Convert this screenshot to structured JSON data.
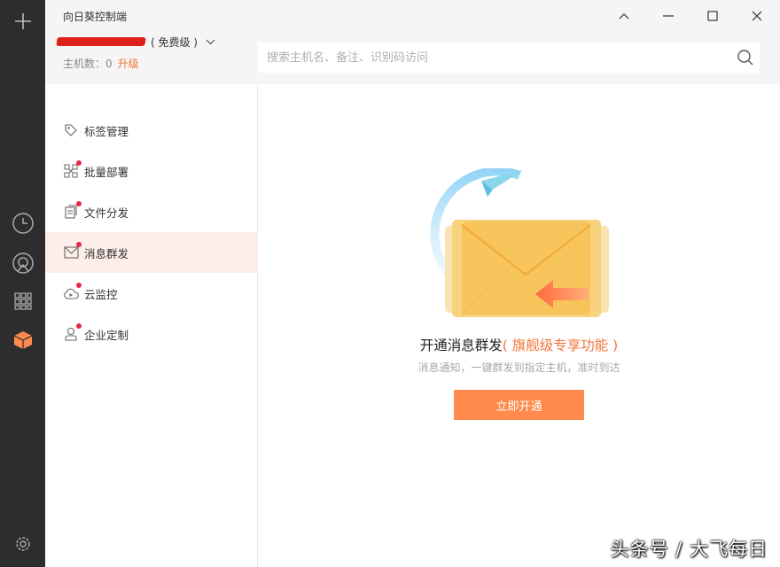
{
  "window": {
    "title": "向日葵控制端"
  },
  "account": {
    "tier": "( 免费级 )",
    "hosts_label": "主机数：0",
    "upgrade_label": "升级"
  },
  "search": {
    "placeholder": "搜索主机名、备注、识别码访问"
  },
  "sidebar": {
    "items": [
      {
        "label": "标签管理",
        "badge": false,
        "active": false
      },
      {
        "label": "批量部署",
        "badge": true,
        "active": false
      },
      {
        "label": "文件分发",
        "badge": true,
        "active": false
      },
      {
        "label": "消息群发",
        "badge": true,
        "active": true
      },
      {
        "label": "云监控",
        "badge": true,
        "active": false
      },
      {
        "label": "企业定制",
        "badge": true,
        "active": false
      }
    ]
  },
  "promo": {
    "title": "开通消息群发",
    "highlight": "( 旗舰级专享功能 )",
    "subtitle": "消息通知，一键群发到指定主机，准时到达",
    "button": "立即开通"
  },
  "watermark": "头条号 / 大飞每日",
  "colors": {
    "accent": "#ff8a4c",
    "highlight_text": "#f0763c",
    "rail": "#2d2d2d",
    "active_bg": "#fdeee8",
    "badge": "#e8264a",
    "envelope": "#f8c55c"
  },
  "icons": {
    "rail": [
      "plus-icon",
      "clock-icon",
      "remote-icon",
      "apps-grid-icon",
      "box-icon",
      "gear-icon"
    ],
    "sidebar": [
      "tag-icon",
      "deploy-icon",
      "file-icon",
      "mail-icon",
      "cloud-monitor-icon",
      "user-icon"
    ],
    "window": [
      "chevron-up-icon",
      "minimize-icon",
      "maximize-icon",
      "close-icon"
    ]
  }
}
